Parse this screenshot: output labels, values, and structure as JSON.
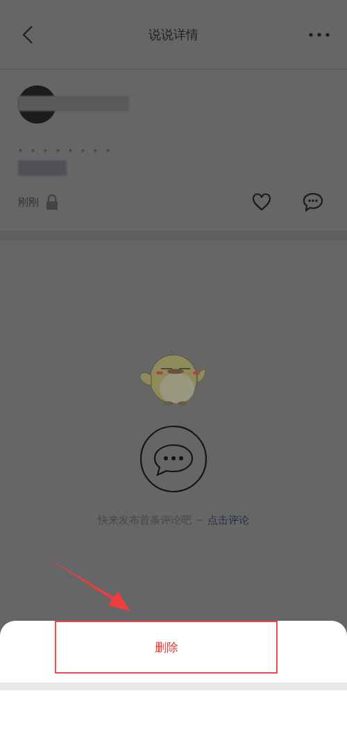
{
  "header": {
    "title": "说说详情"
  },
  "post": {
    "content": "。。。。。。。。",
    "time": "刚刚"
  },
  "empty_state": {
    "text": "快来发布首条评论吧 ~ ",
    "link": "点击评论"
  },
  "action_sheet": {
    "items": [
      {
        "label": "删除",
        "kind": "destructive",
        "highlighted": true
      }
    ]
  }
}
